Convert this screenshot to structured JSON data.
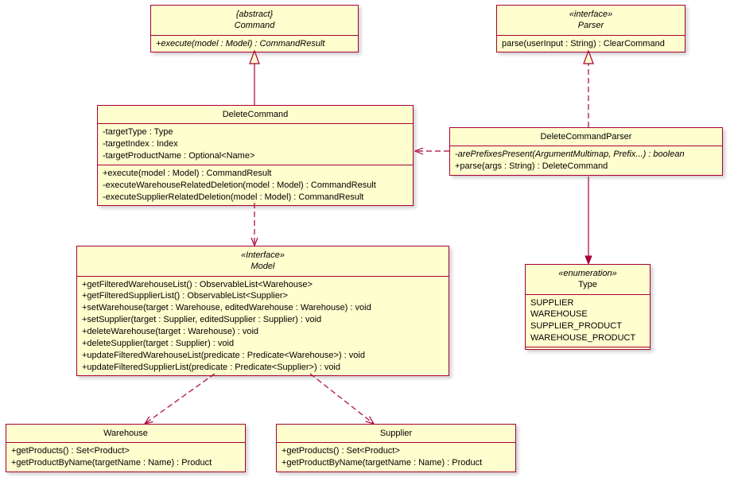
{
  "classes": {
    "command": {
      "stereo": "{abstract}",
      "name": "Command",
      "ops": [
        "+execute(model : Model) : CommandResult"
      ]
    },
    "parser": {
      "stereo": "«interface»",
      "name": "Parser",
      "ops": [
        "parse(userInput : String) : ClearCommand"
      ]
    },
    "deleteCommand": {
      "name": "DeleteCommand",
      "attrs": [
        "-targetType : Type",
        "-targetIndex : Index",
        "-targetProductName : Optional<Name>"
      ],
      "ops": [
        "+execute(model : Model) : CommandResult",
        "-executeWarehouseRelatedDeletion(model : Model) : CommandResult",
        "-executeSupplierRelatedDeletion(model : Model) : CommandResult"
      ]
    },
    "deleteCommandParser": {
      "name": "DeleteCommandParser",
      "ops": [
        "-arePrefixesPresent(ArgumentMultimap, Prefix...) : boolean",
        "+parse(args : String) : DeleteCommand"
      ]
    },
    "model": {
      "stereo": "«Interface»",
      "name": "Model",
      "ops": [
        "+getFilteredWarehouseList() : ObservableList<Warehouse>",
        "+getFilteredSupplierList() : ObservableList<Supplier>",
        "+setWarehouse(target : Warehouse, editedWarehouse : Warehouse) : void",
        "+setSupplier(target : Supplier, editedSupplier : Supplier) : void",
        "+deleteWarehouse(target : Warehouse) : void",
        "+deleteSupplier(target : Supplier) : void",
        "+updateFilteredWarehouseList(predicate : Predicate<Warehouse>) : void",
        "+updateFilteredSupplierList(predicate : Predicate<Supplier>) : void"
      ]
    },
    "type": {
      "stereo": "«enumeration»",
      "name": "Type",
      "lits": [
        "SUPPLIER",
        "WAREHOUSE",
        "SUPPLIER_PRODUCT",
        "WAREHOUSE_PRODUCT"
      ]
    },
    "warehouse": {
      "name": "Warehouse",
      "ops": [
        "+getProducts() : Set<Product>",
        "+getProductByName(targetName : Name) : Product"
      ]
    },
    "supplier": {
      "name": "Supplier",
      "ops": [
        "+getProducts() : Set<Product>",
        "+getProductByName(targetName : Name) : Product"
      ]
    }
  },
  "chart_data": {
    "type": "table",
    "diagram_type": "UML class diagram",
    "classes": [
      {
        "name": "Command",
        "kind": "abstract",
        "operations": [
          "+execute(model : Model) : CommandResult"
        ]
      },
      {
        "name": "Parser",
        "kind": "interface",
        "operations": [
          "parse(userInput : String) : ClearCommand"
        ]
      },
      {
        "name": "DeleteCommand",
        "kind": "class",
        "attributes": [
          "-targetType : Type",
          "-targetIndex : Index",
          "-targetProductName : Optional<Name>"
        ],
        "operations": [
          "+execute(model : Model) : CommandResult",
          "-executeWarehouseRelatedDeletion(model : Model) : CommandResult",
          "-executeSupplierRelatedDeletion(model : Model) : CommandResult"
        ]
      },
      {
        "name": "DeleteCommandParser",
        "kind": "class",
        "operations": [
          "-arePrefixesPresent(ArgumentMultimap, Prefix...) : boolean",
          "+parse(args : String) : DeleteCommand"
        ]
      },
      {
        "name": "Model",
        "kind": "interface",
        "operations": [
          "+getFilteredWarehouseList() : ObservableList<Warehouse>",
          "+getFilteredSupplierList() : ObservableList<Supplier>",
          "+setWarehouse(target : Warehouse, editedWarehouse : Warehouse) : void",
          "+setSupplier(target : Supplier, editedSupplier : Supplier) : void",
          "+deleteWarehouse(target : Warehouse) : void",
          "+deleteSupplier(target : Supplier) : void",
          "+updateFilteredWarehouseList(predicate : Predicate<Warehouse>) : void",
          "+updateFilteredSupplierList(predicate : Predicate<Supplier>) : void"
        ]
      },
      {
        "name": "Type",
        "kind": "enumeration",
        "literals": [
          "SUPPLIER",
          "WAREHOUSE",
          "SUPPLIER_PRODUCT",
          "WAREHOUSE_PRODUCT"
        ]
      },
      {
        "name": "Warehouse",
        "kind": "class",
        "operations": [
          "+getProducts() : Set<Product>",
          "+getProductByName(targetName : Name) : Product"
        ]
      },
      {
        "name": "Supplier",
        "kind": "class",
        "operations": [
          "+getProducts() : Set<Product>",
          "+getProductByName(targetName : Name) : Product"
        ]
      }
    ],
    "relationships": [
      {
        "from": "DeleteCommand",
        "to": "Command",
        "type": "generalization"
      },
      {
        "from": "DeleteCommandParser",
        "to": "Parser",
        "type": "realization"
      },
      {
        "from": "DeleteCommandParser",
        "to": "DeleteCommand",
        "type": "dependency"
      },
      {
        "from": "DeleteCommandParser",
        "to": "Type",
        "type": "association"
      },
      {
        "from": "DeleteCommand",
        "to": "Model",
        "type": "dependency"
      },
      {
        "from": "Model",
        "to": "Warehouse",
        "type": "dependency"
      },
      {
        "from": "Model",
        "to": "Supplier",
        "type": "dependency"
      }
    ]
  }
}
